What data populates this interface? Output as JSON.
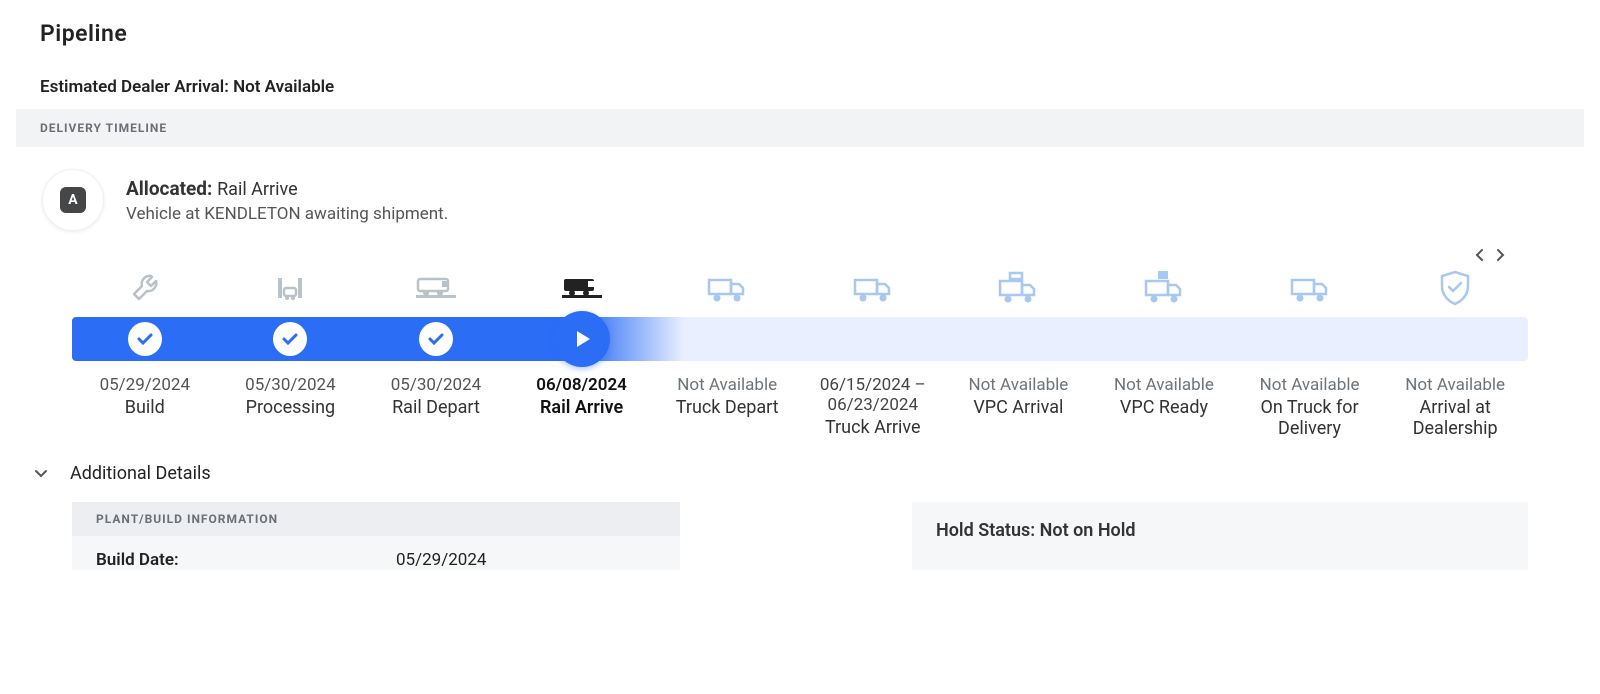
{
  "page": {
    "title": "Pipeline"
  },
  "estimate": {
    "label": "Estimated Dealer Arrival:",
    "value": "Not Available"
  },
  "timeline": {
    "section_label": "DELIVERY TIMELINE",
    "status_badge_letter": "A",
    "status_title_prefix": "Allocated:",
    "status_title_suffix": "Rail Arrive",
    "status_description": "Vehicle at KENDLETON awaiting shipment.",
    "progress_fill_percent": 33,
    "steps": [
      {
        "icon": "wrench",
        "date": "05/29/2024",
        "label": "Build",
        "state": "done"
      },
      {
        "icon": "carwash",
        "date": "05/30/2024",
        "label": "Processing",
        "state": "done"
      },
      {
        "icon": "train",
        "date": "05/30/2024",
        "label": "Rail Depart",
        "state": "done"
      },
      {
        "icon": "train-dark",
        "date": "06/08/2024",
        "label": "Rail Arrive",
        "state": "current"
      },
      {
        "icon": "truck",
        "date": "Not Available",
        "label": "Truck Depart",
        "state": "future-na"
      },
      {
        "icon": "truck",
        "date": "06/15/2024 – 06/23/2024",
        "label": "Truck Arrive",
        "state": "future"
      },
      {
        "icon": "truck-box",
        "date": "Not Available",
        "label": "VPC Arrival",
        "state": "future-na"
      },
      {
        "icon": "truck-door",
        "date": "Not Available",
        "label": "VPC Ready",
        "state": "future-na"
      },
      {
        "icon": "truck",
        "date": "Not Available",
        "label": "On Truck for Delivery",
        "state": "future-na"
      },
      {
        "icon": "shield-check",
        "date": "Not Available",
        "label": "Arrival at Dealership",
        "state": "future-na"
      }
    ]
  },
  "details": {
    "toggle_label": "Additional Details",
    "plant_section_label": "PLANT/BUILD INFORMATION",
    "rows": [
      {
        "label": "Build Date:",
        "value": "05/29/2024"
      }
    ],
    "hold_label": "Hold Status:",
    "hold_value": "Not on Hold"
  }
}
